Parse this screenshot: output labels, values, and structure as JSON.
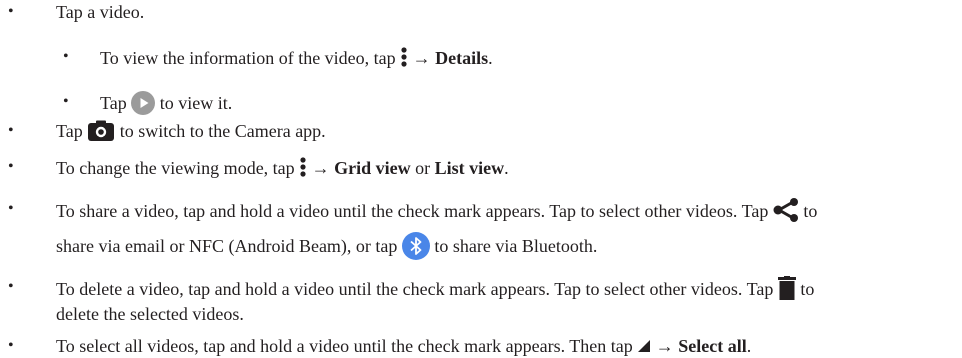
{
  "bullet_char": "•",
  "items": [
    {
      "text": "Tap a video."
    },
    {
      "pre": "To view the information of the video, tap ",
      "arrow": "→",
      "bold": "Details",
      "post": "."
    },
    {
      "pre": "Tap ",
      "post": " to view it."
    },
    {
      "pre": "Tap ",
      "post": " to switch to the Camera app."
    },
    {
      "pre": "To change the viewing mode, tap ",
      "arrow": "→",
      "bold1": "Grid view",
      "mid": " or ",
      "bold2": "List view",
      "post": "."
    },
    {
      "pre": "To share a video, tap and hold a video until the check mark appears. Tap to select other videos. Tap ",
      "mid": " to",
      "line2_pre": "share via email or NFC (Android Beam), or tap ",
      "line2_post": " to share via Bluetooth."
    },
    {
      "pre": "To delete a video, tap and hold a video until the check mark appears. Tap to select other videos. Tap ",
      "mid": " to",
      "line2": "delete the selected videos."
    },
    {
      "pre": "To select all videos, tap and hold a video until the check mark appears. Then tap ",
      "arrow": "→",
      "bold": "Select all",
      "post": "."
    }
  ],
  "colors": {
    "text": "#231f20",
    "play_circle": "#9b9b9b",
    "bluetooth_circle": "#4a86e8"
  },
  "icons": [
    "more-vert-icon",
    "play-icon",
    "camera-icon",
    "share-icon",
    "bluetooth-icon",
    "trash-icon",
    "dropdown-triangle-icon"
  ]
}
